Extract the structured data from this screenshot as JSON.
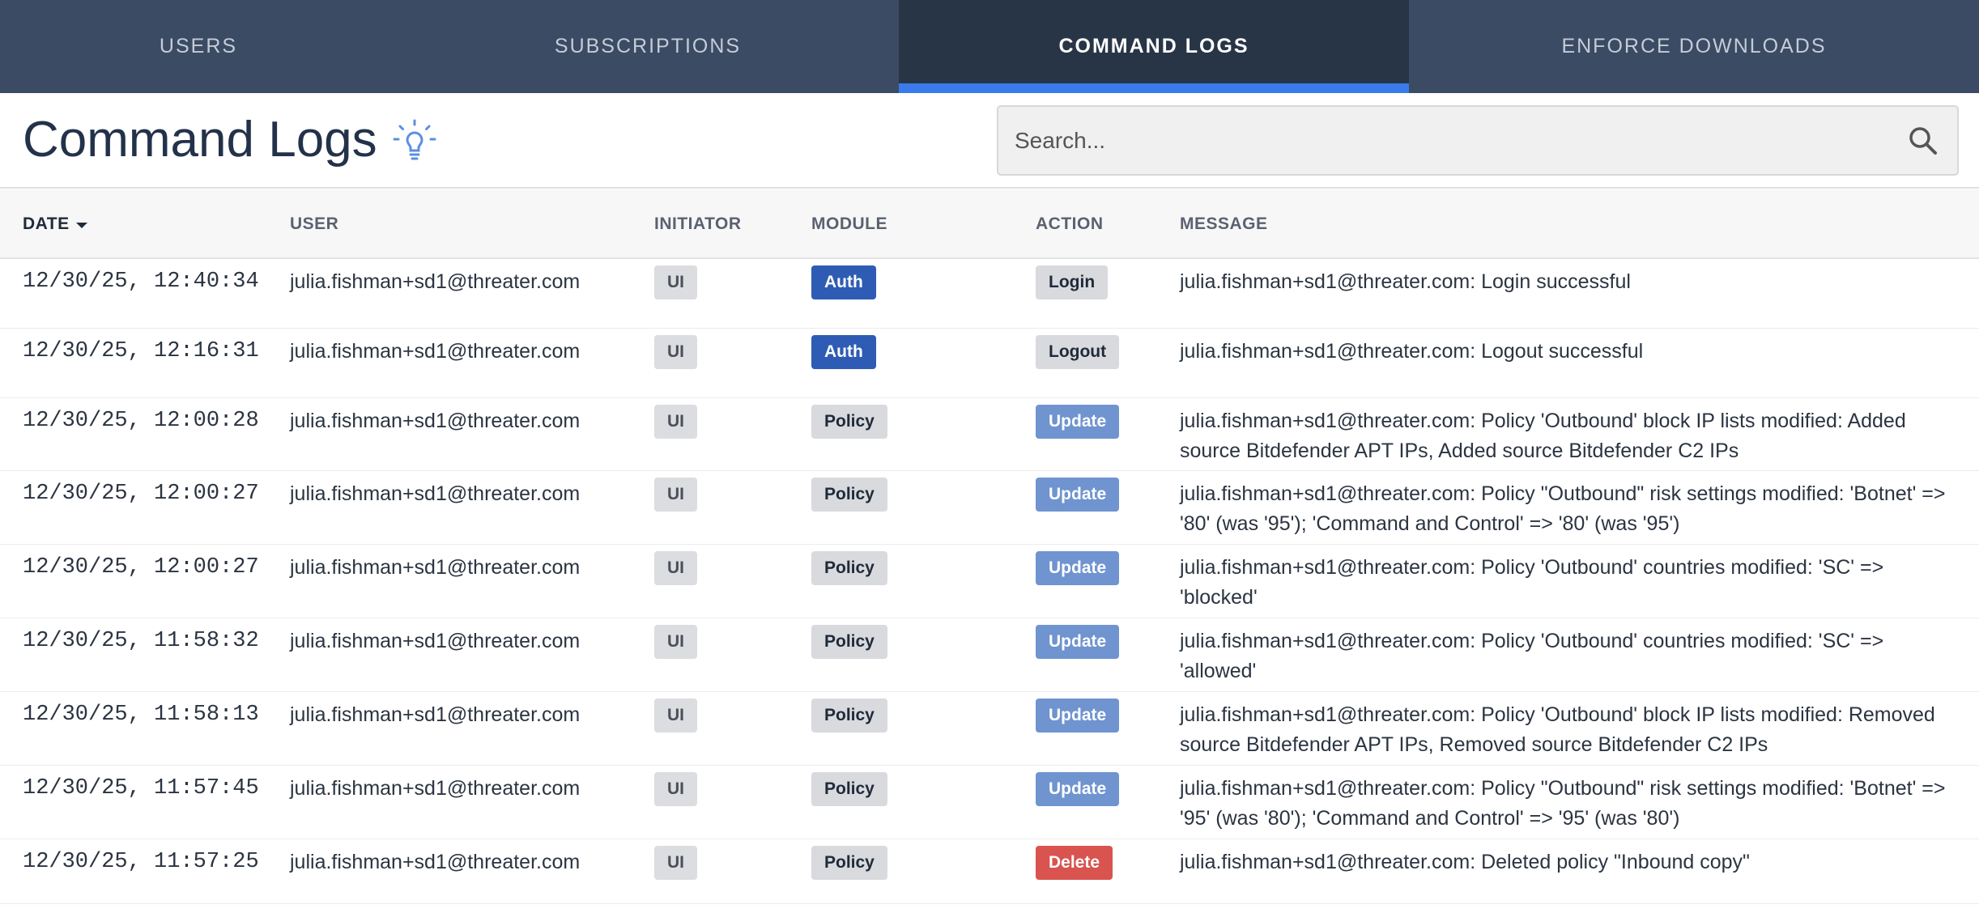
{
  "tabs": [
    {
      "label": "USERS"
    },
    {
      "label": "SUBSCRIPTIONS"
    },
    {
      "label": "COMMAND LOGS"
    },
    {
      "label": "ENFORCE DOWNLOADS"
    }
  ],
  "page": {
    "title": "Command Logs",
    "icon": "lightbulb-icon"
  },
  "search": {
    "placeholder": "Search...",
    "icon": "search-icon"
  },
  "columns": {
    "date": "DATE",
    "user": "USER",
    "initiator": "INITIATOR",
    "module": "MODULE",
    "action": "ACTION",
    "message": "MESSAGE"
  },
  "colors": {
    "tab_active_underline": "#3a7bea",
    "auth": "#2e5cb4",
    "update": "#6f94cf",
    "delete": "#d9534f"
  },
  "rows": [
    {
      "date": "12/30/25, 12:40:34",
      "user": "julia.fishman+sd1@threater.com",
      "initiator": "UI",
      "module": "Auth",
      "action": "Login",
      "message": "julia.fishman+sd1@threater.com: Login successful"
    },
    {
      "date": "12/30/25, 12:16:31",
      "user": "julia.fishman+sd1@threater.com",
      "initiator": "UI",
      "module": "Auth",
      "action": "Logout",
      "message": "julia.fishman+sd1@threater.com: Logout successful"
    },
    {
      "date": "12/30/25, 12:00:28",
      "user": "julia.fishman+sd1@threater.com",
      "initiator": "UI",
      "module": "Policy",
      "action": "Update",
      "message": "julia.fishman+sd1@threater.com: Policy 'Outbound' block IP lists modified: Added source Bitdefender APT IPs, Added source Bitdefender C2 IPs"
    },
    {
      "date": "12/30/25, 12:00:27",
      "user": "julia.fishman+sd1@threater.com",
      "initiator": "UI",
      "module": "Policy",
      "action": "Update",
      "message": "julia.fishman+sd1@threater.com: Policy \"Outbound\" risk settings modified: 'Botnet' => '80' (was '95'); 'Command and Control' => '80' (was '95')"
    },
    {
      "date": "12/30/25, 12:00:27",
      "user": "julia.fishman+sd1@threater.com",
      "initiator": "UI",
      "module": "Policy",
      "action": "Update",
      "message": "julia.fishman+sd1@threater.com: Policy 'Outbound' countries modified: 'SC' => 'blocked'"
    },
    {
      "date": "12/30/25, 11:58:32",
      "user": "julia.fishman+sd1@threater.com",
      "initiator": "UI",
      "module": "Policy",
      "action": "Update",
      "message": "julia.fishman+sd1@threater.com: Policy 'Outbound' countries modified: 'SC' => 'allowed'"
    },
    {
      "date": "12/30/25, 11:58:13",
      "user": "julia.fishman+sd1@threater.com",
      "initiator": "UI",
      "module": "Policy",
      "action": "Update",
      "message": "julia.fishman+sd1@threater.com: Policy 'Outbound' block IP lists modified: Removed source Bitdefender APT IPs, Removed source Bitdefender C2 IPs"
    },
    {
      "date": "12/30/25, 11:57:45",
      "user": "julia.fishman+sd1@threater.com",
      "initiator": "UI",
      "module": "Policy",
      "action": "Update",
      "message": "julia.fishman+sd1@threater.com: Policy \"Outbound\" risk settings modified: 'Botnet' => '95' (was '80'); 'Command and Control' => '95' (was '80')"
    },
    {
      "date": "12/30/25, 11:57:25",
      "user": "julia.fishman+sd1@threater.com",
      "initiator": "UI",
      "module": "Policy",
      "action": "Delete",
      "message": "julia.fishman+sd1@threater.com: Deleted policy \"Inbound copy\""
    }
  ]
}
